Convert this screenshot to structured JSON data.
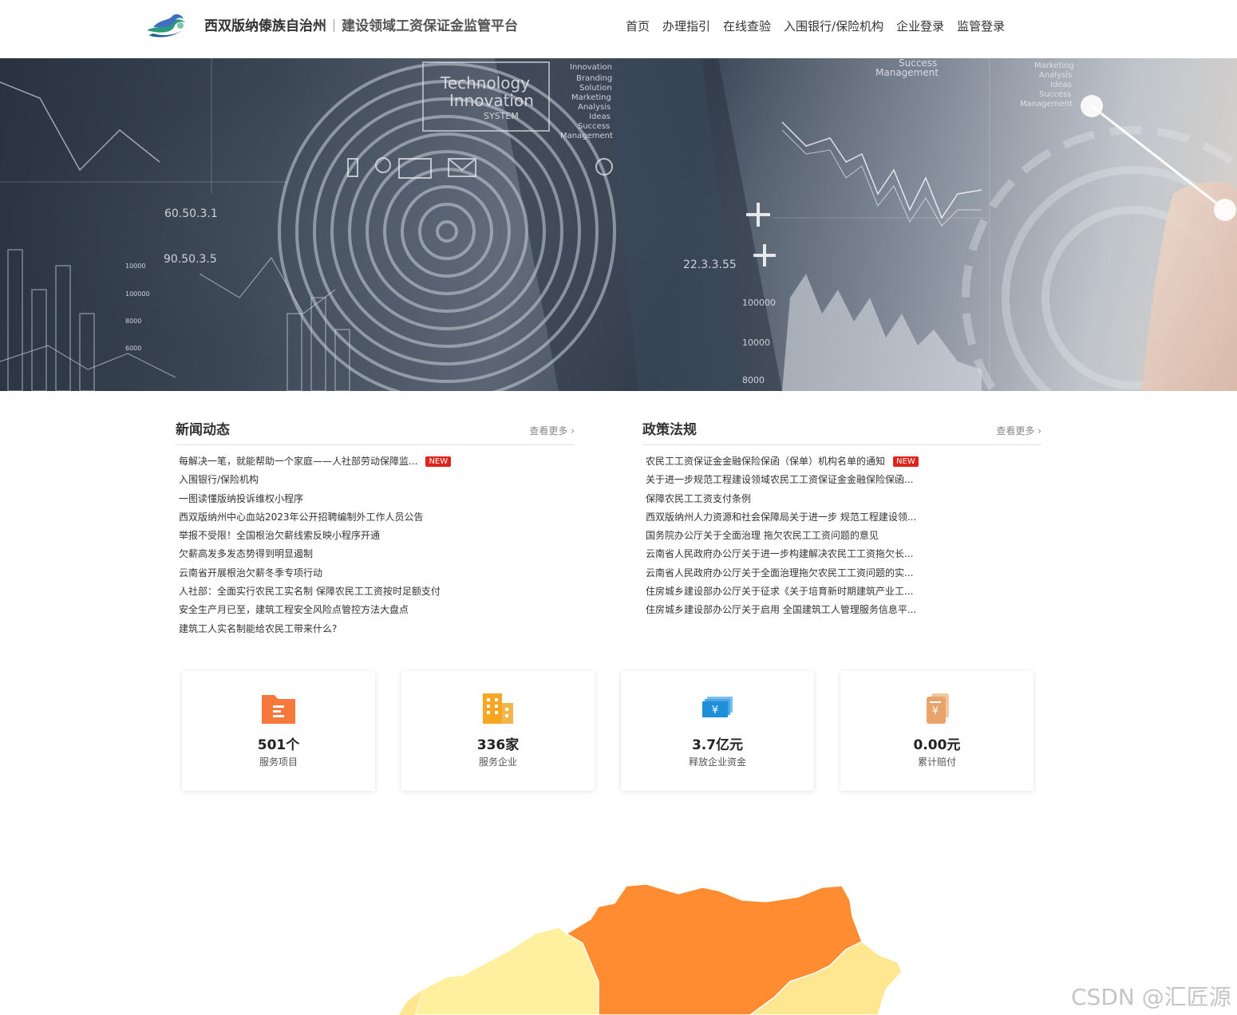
{
  "header": {
    "brand_name": "西双版纳傣族自治州",
    "brand_sub": "建设领域工资保证金监管平台",
    "nav": [
      "首页",
      "办理指引",
      "在线查验",
      "入围银行/保险机构",
      "企业登录",
      "监管登录"
    ]
  },
  "banner": {
    "texts": [
      "Technology",
      "Innovation",
      "SYSTEM",
      "Innovation",
      "Branding",
      "Solution",
      "Marketing",
      "Analysis",
      "Ideas",
      "Success",
      "Management",
      "60.50.3.1",
      "90.50.3.5",
      "22.3.3.55",
      "Success",
      "Management",
      "Marketing",
      "Analysis",
      "Ideas",
      "Success",
      "Management",
      "100000",
      "10000",
      "8000",
      "10000",
      "100000",
      "6000",
      "8000"
    ]
  },
  "news": {
    "title": "新闻动态",
    "more": "查看更多 ›",
    "items": [
      "每解决一笔，就能帮助一个家庭——人社部劳动保障监...",
      "入围银行/保险机构",
      "一图读懂版纳投诉维权小程序",
      "西双版纳州中心血站2023年公开招聘编制外工作人员公告",
      "举报不受限！全国根治欠薪线索反映小程序开通",
      "欠薪高发多发态势得到明显遏制",
      "云南省开展根治欠薪冬季专项行动",
      "人社部：全面实行农民工实名制 保障农民工工资按时足额支付",
      "安全生产月已至，建筑工程安全风险点管控方法大盘点",
      "建筑工人实名制能给农民工带来什么?"
    ],
    "badge": "NEW"
  },
  "policy": {
    "title": "政策法规",
    "more": "查看更多 ›",
    "items": [
      "农民工工资保证金金融保险保函（保单）机构名单的通知",
      "关于进一步规范工程建设领域农民工工资保证金金融保险保函...",
      "保障农民工工资支付条例",
      "西双版纳州人力资源和社会保障局关于进一步 规范工程建设领...",
      "国务院办公厅关于全面治理 拖欠农民工工资问题的意见",
      "云南省人民政府办公厅关于进一步构建解决农民工工资拖欠长...",
      "云南省人民政府办公厅关于全面治理拖欠农民工工资问题的实...",
      "住房城乡建设部办公厅关于征求《关于培育新时期建筑产业工...",
      "住房城乡建设部办公厅关于启用 全国建筑工人管理服务信息平..."
    ],
    "badge": "NEW"
  },
  "stats": [
    {
      "value": "501个",
      "label": "服务项目",
      "icon": "folder-icon",
      "color": "#f6783a"
    },
    {
      "value": "336家",
      "label": "服务企业",
      "icon": "building-icon",
      "color": "#f6a623"
    },
    {
      "value": "3.7亿元",
      "label": "释放企业资金",
      "icon": "money-icon",
      "color": "#1e8fd8"
    },
    {
      "value": "0.00元",
      "label": "累计赔付",
      "icon": "receipt-icon",
      "color": "#e8a46a"
    }
  ],
  "map": {
    "colors": {
      "high": "#ff8c30",
      "low": "#fff0a0",
      "mid": "#ffe690"
    }
  },
  "watermark": "CSDN @汇匠源"
}
